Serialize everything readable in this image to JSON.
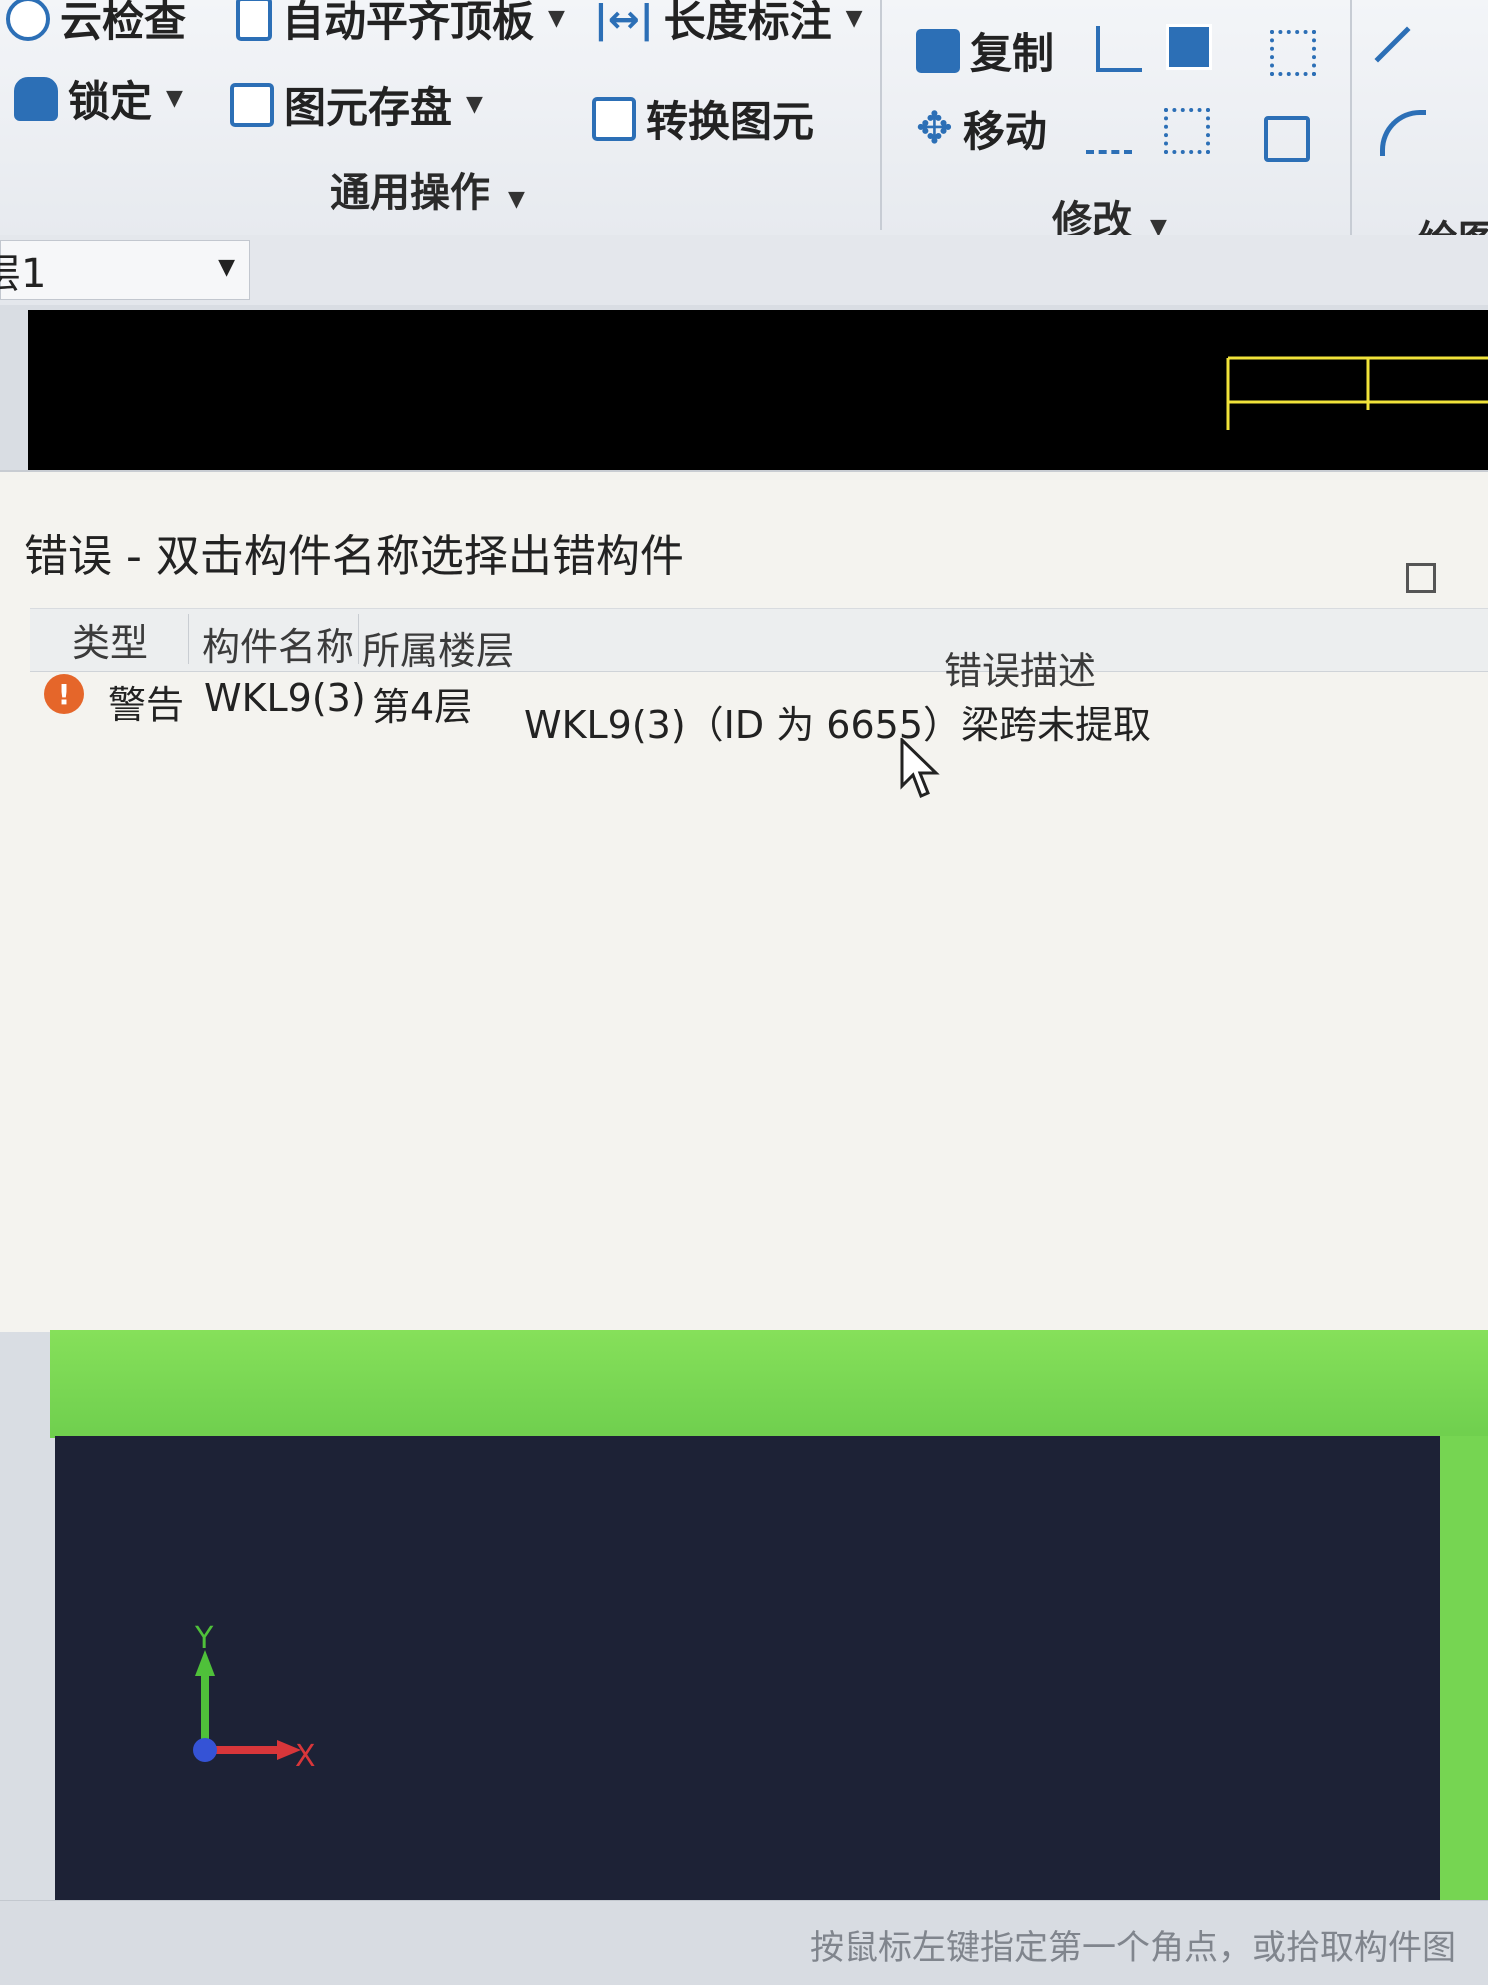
{
  "ribbon": {
    "tools": {
      "cloud_check": "云检查",
      "auto_align": "自动平齐顶板",
      "dimension": "长度标注",
      "lock": "锁定",
      "save_element": "图元存盘",
      "convert_element": "转换图元",
      "copy": "复制",
      "move": "移动"
    },
    "groups": {
      "general": "通用操作",
      "modify": "修改",
      "draw": "绘图"
    }
  },
  "floor_selector": {
    "value": "层1"
  },
  "error_panel": {
    "title": "错误 - 双击构件名称选择出错构件",
    "columns": {
      "type": "类型",
      "name": "构件名称",
      "floor": "所属楼层",
      "description": "错误描述"
    },
    "rows": [
      {
        "type": "警告",
        "name": "WKL9(3)",
        "floor": "第4层",
        "description": "WKL9(3)（ID 为 6655）梁跨未提取"
      }
    ]
  },
  "axes": {
    "y": "Y",
    "x": "X"
  },
  "status_bar": {
    "hint": "按鼠标左键指定第一个角点，或拾取构件图"
  },
  "colors": {
    "warning": "#e5662a",
    "canvas_top": "#000000",
    "canvas_bottom": "#1d2236",
    "green_band": "#76d552",
    "ribbon_icon": "#2c6fb6"
  }
}
